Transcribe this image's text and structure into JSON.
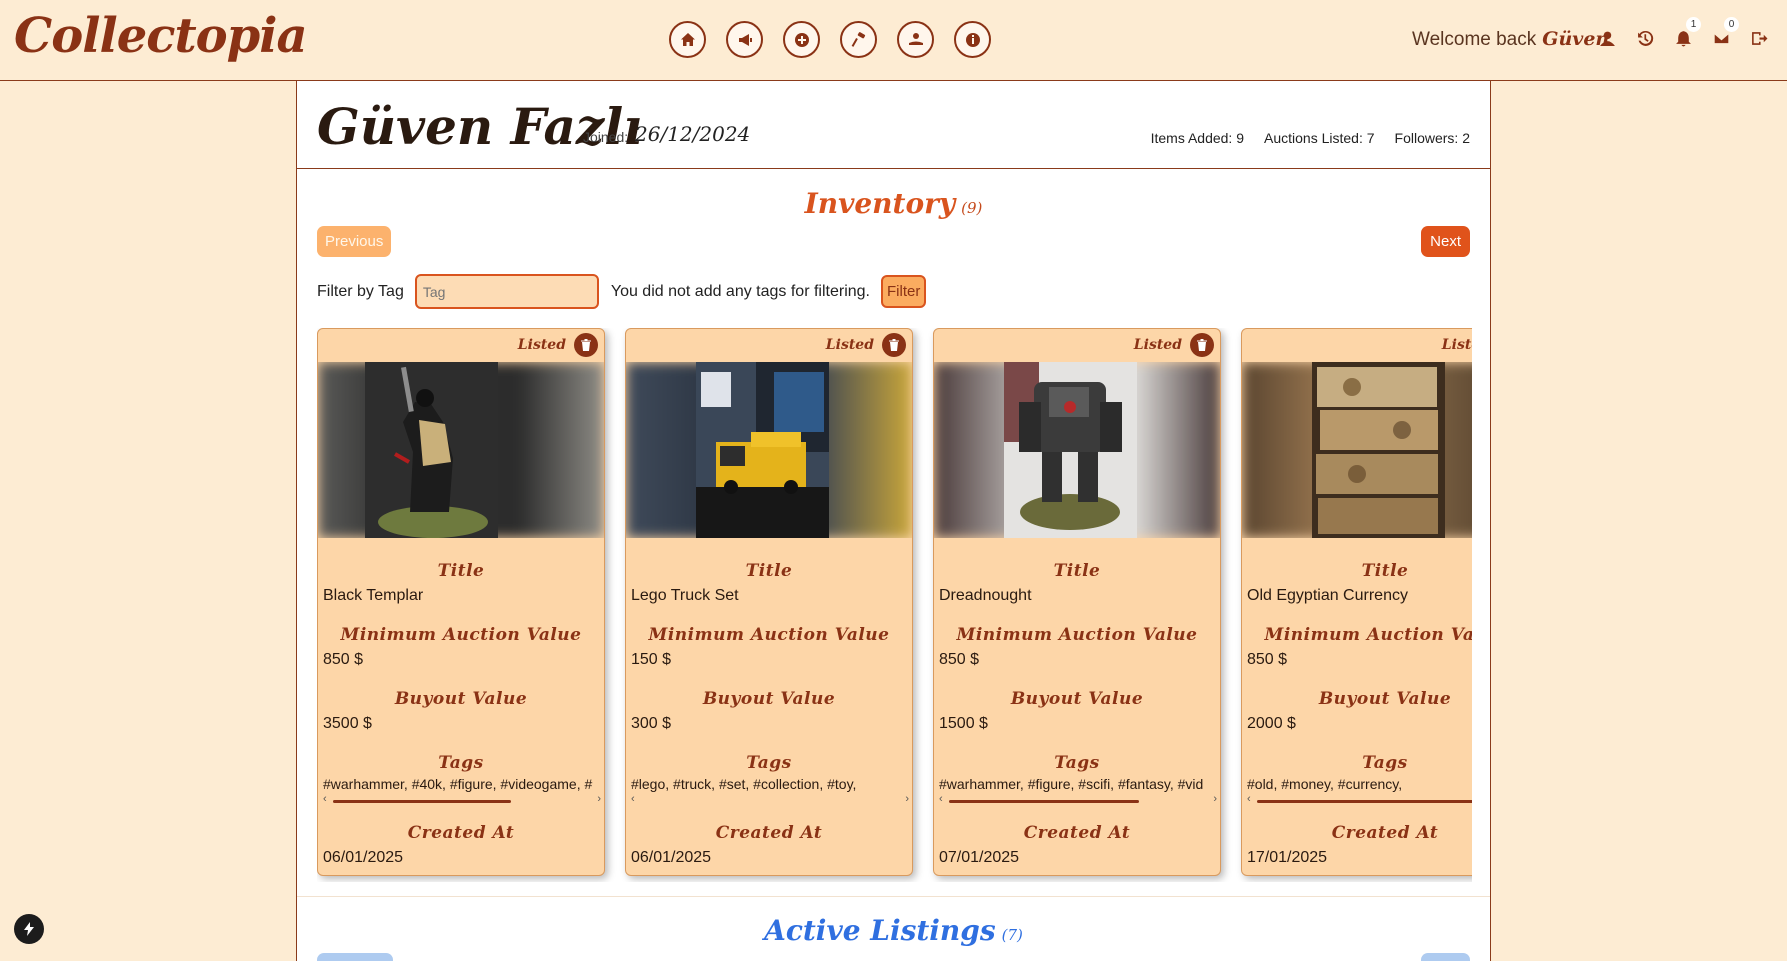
{
  "app": {
    "logo": "Collectopia"
  },
  "nav": {
    "items": [
      {
        "icon": "home-icon"
      },
      {
        "icon": "megaphone-icon"
      },
      {
        "icon": "plus-circle-icon"
      },
      {
        "icon": "auction-gavel-icon"
      },
      {
        "icon": "hand-coin-icon"
      },
      {
        "icon": "info-icon"
      }
    ]
  },
  "header": {
    "welcome": "Welcome back",
    "username": "Güven",
    "notifications_count": "1",
    "messages_count": "0"
  },
  "profile": {
    "name": "Güven Fazlı",
    "joined_label": "Joined:",
    "joined_date": "26/12/2024",
    "items_added": "Items Added: 9",
    "auctions_listed": "Auctions Listed: 7",
    "followers": "Followers: 2"
  },
  "inventory": {
    "title": "Inventory",
    "count": "(9)",
    "prev": "Previous",
    "next": "Next",
    "filter_label": "Filter by Tag",
    "filter_placeholder": "Tag",
    "filter_message": "You did not add any tags for filtering.",
    "filter_button": "Filter",
    "labels": {
      "title": "Title",
      "min_auction": "Minimum Auction Value",
      "buyout": "Buyout Value",
      "tags": "Tags",
      "created": "Created At"
    },
    "items": [
      {
        "status": "Listed",
        "title": "Black Templar",
        "min_auction": "850 $",
        "buyout": "3500 $",
        "tags": "#warhammer, #40k, #figure, #videogame, #",
        "created": "06/01/2025"
      },
      {
        "status": "Listed",
        "title": "Lego Truck Set",
        "min_auction": "150 $",
        "buyout": "300 $",
        "tags": "#lego, #truck, #set, #collection, #toy,",
        "created": "06/01/2025"
      },
      {
        "status": "Listed",
        "title": "Dreadnought",
        "min_auction": "850 $",
        "buyout": "1500 $",
        "tags": "#warhammer, #figure, #scifi, #fantasy, #vid",
        "created": "07/01/2025"
      },
      {
        "status": "Listed",
        "title": "Old Egyptian Currency",
        "min_auction": "850 $",
        "buyout": "2000 $",
        "tags": "#old, #money, #currency,",
        "created": "17/01/2025"
      }
    ]
  },
  "active_listings": {
    "title": "Active Listings",
    "count": "(7)"
  },
  "colors": {
    "brand": "#8a3215",
    "accent": "#e0531b",
    "card": "#fdd6a8",
    "listings": "#2f6fe0"
  }
}
